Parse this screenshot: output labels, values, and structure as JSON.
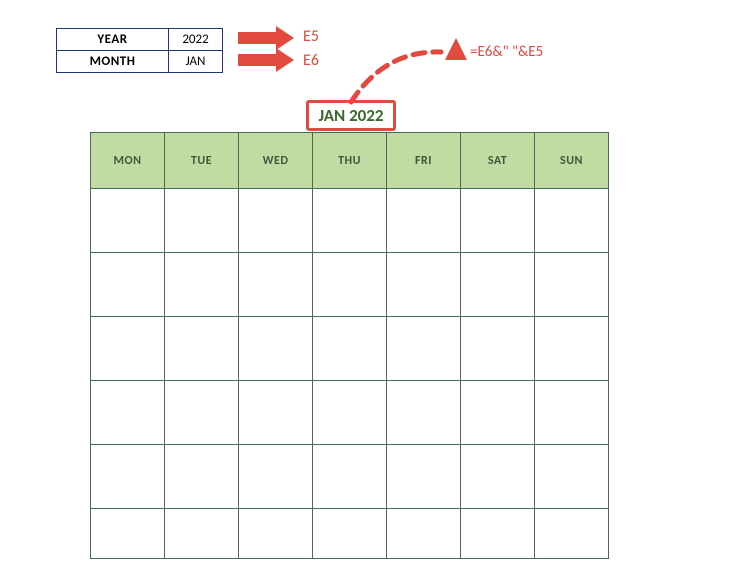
{
  "input": {
    "year_label": "YEAR",
    "year_value": "2022",
    "month_label": "MONTH",
    "month_value": "JAN"
  },
  "refs": {
    "e5": "E5",
    "e6": "E6",
    "formula": "=E6&\" \"&E5"
  },
  "calendar": {
    "title": "JAN 2022",
    "days": [
      "MON",
      "TUE",
      "WED",
      "THU",
      "FRI",
      "SAT",
      "SUN"
    ]
  }
}
